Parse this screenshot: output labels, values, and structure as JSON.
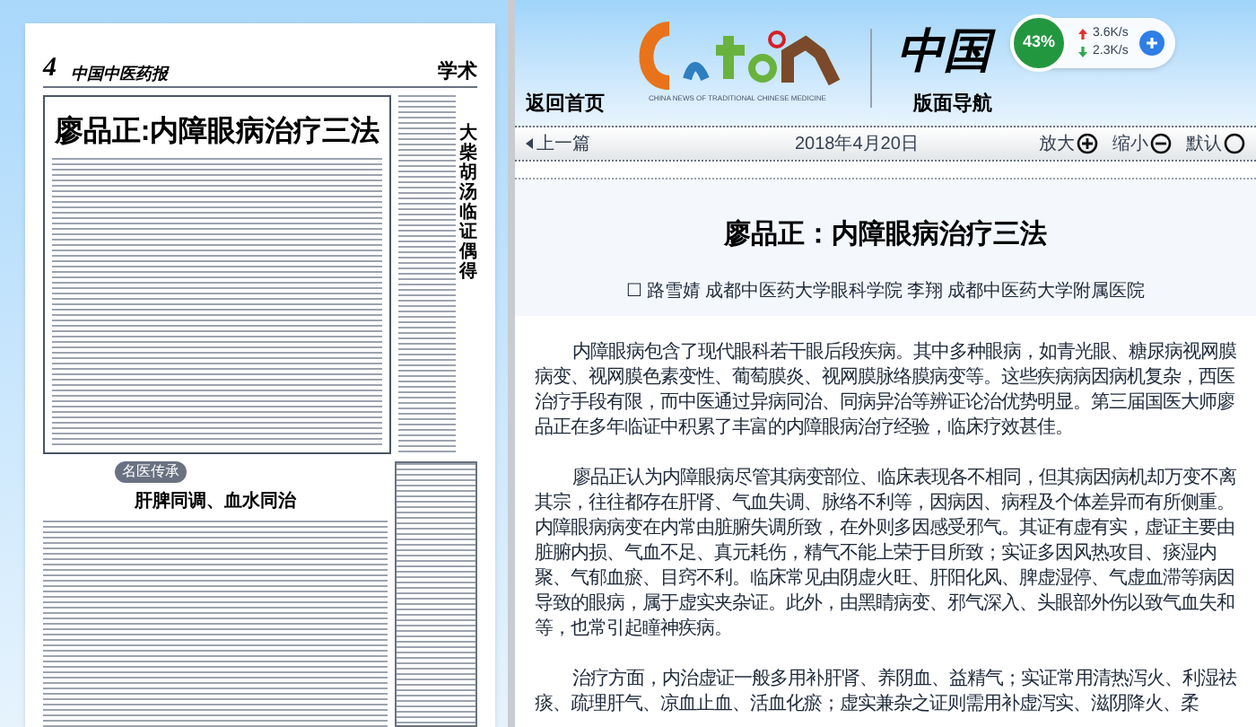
{
  "newspaper_page": {
    "page_number": "4",
    "masthead": "中国中医药报",
    "section": "学术",
    "lead_headline": "廖品正:内障眼病治疗三法",
    "side_headline": "大柴胡汤临证偶得",
    "column_badge": "名医传承",
    "second_headline": "肝脾同调、血水同治"
  },
  "header": {
    "home_link": "返回首页",
    "logo_caption": "CHINA NEWS OF TRADITIONAL CHINESE MEDICINE",
    "masthead": "中国",
    "page_nav_link": "版面导航"
  },
  "toolbar": {
    "prev_link": "上一篇",
    "date": "2018年4月20日",
    "zoom": [
      {
        "kind": "in",
        "label": "放大"
      },
      {
        "kind": "out",
        "label": "缩小"
      },
      {
        "kind": "reset",
        "label": "默认"
      }
    ]
  },
  "article": {
    "title": "廖品正：内障眼病治疗三法",
    "byline": "☐ 路雪婧 成都中医药大学眼科学院 李翔 成都中医药大学附属医院",
    "paragraphs": [
      "内障眼病包含了现代眼科若干眼后段疾病。其中多种眼病，如青光眼、糖尿病视网膜病变、视网膜色素变性、葡萄膜炎、视网膜脉络膜病变等。这些疾病病因病机复杂，西医治疗手段有限，而中医通过异病同治、同病异治等辨证论治优势明显。第三届国医大师廖品正在多年临证中积累了丰富的内障眼病治疗经验，临床疗效甚佳。",
      "廖品正认为内障眼病尽管其病变部位、临床表现各不相同，但其病因病机却万变不离其宗，往往都存在肝肾、气血失调、脉络不利等，因病因、病程及个体差异而有所侧重。内障眼病病变在内常由脏腑失调所致，在外则多因感受邪气。其证有虚有实，虚证主要由脏腑内损、气血不足、真元耗伤，精气不能上荣于目所致；实证多因风热攻目、痰湿内聚、气郁血瘀、目窍不利。临床常见由阴虚火旺、肝阳化风、脾虚湿停、气虚血滞等病因导致的眼病，属于虚实夹杂证。此外，由黑睛病变、邪气深入、头眼部外伤以致气血失和等，也常引起瞳神疾病。",
      "治疗方面，内治虚证一般多用补肝肾、养阴血、益精气；实证常用清热泻火、利湿祛痰、疏理肝气、凉血止血、活血化瘀；虚实兼杂之证则需用补虚泻实、滋阴降火、柔"
    ]
  },
  "network_widget": {
    "percent": "43%",
    "upload": "3.6K/s",
    "download": "2.3K/s"
  }
}
